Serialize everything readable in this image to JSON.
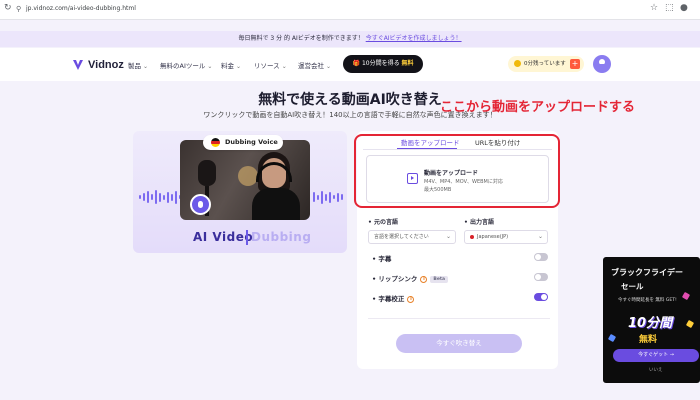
{
  "browser": {
    "url": "jp.vidnoz.com/ai-video-dubbing.html"
  },
  "announcement": {
    "text": "毎日無料で 3 分 的 AIビデオを制作できます！",
    "link": "今すぐAIビデオを作成しましょう！"
  },
  "header": {
    "logo": "Vidnoz",
    "nav": [
      "製品",
      "無料のAIツール",
      "料金",
      "リソース",
      "運営会社"
    ],
    "cta_prefix": "10分間を得る",
    "cta_free": "無料",
    "credits": "0分残っています"
  },
  "hero": {
    "title": "無料で使える動画AI吹き替え",
    "subtitle": "ワンクリックで動画を自動AI吹き替え！140以上の言語で手軽に自然な声色に置き換えます！",
    "annotation": "ここから動画をアップロードする"
  },
  "preview": {
    "badge": "Dubbing Voice",
    "ai_video": "AI Video",
    "dubbing": "Dubbing"
  },
  "form": {
    "tabs": [
      "動画をアップロード",
      "URLを貼り付け"
    ],
    "upload_title": "動画をアップロード",
    "upload_formats": "M4V、MP4、MOV、WEBMに対応",
    "upload_size": "最大500MB",
    "source_label": "元の言語",
    "source_placeholder": "言語を選択してください",
    "target_label": "出力言語",
    "target_value": "Japanese(JP)",
    "options": [
      {
        "label": "字幕",
        "on": false
      },
      {
        "label": "リップシンク",
        "on": false,
        "badge": "Beta"
      },
      {
        "label": "字幕校正",
        "on": true
      }
    ],
    "submit": "今すぐ吹き替え"
  },
  "promo": {
    "title": "ブラックフライデー",
    "subtitle": "セール",
    "small": "今すぐ時間延長を 無料 GET!",
    "big": "10分間",
    "free": "無料",
    "button": "今すぐゲット →",
    "later": "いいえ"
  },
  "colors": {
    "accent": "#6a4ce0",
    "annotation_red": "#e42535",
    "promo_bg": "#0c0c0c"
  }
}
